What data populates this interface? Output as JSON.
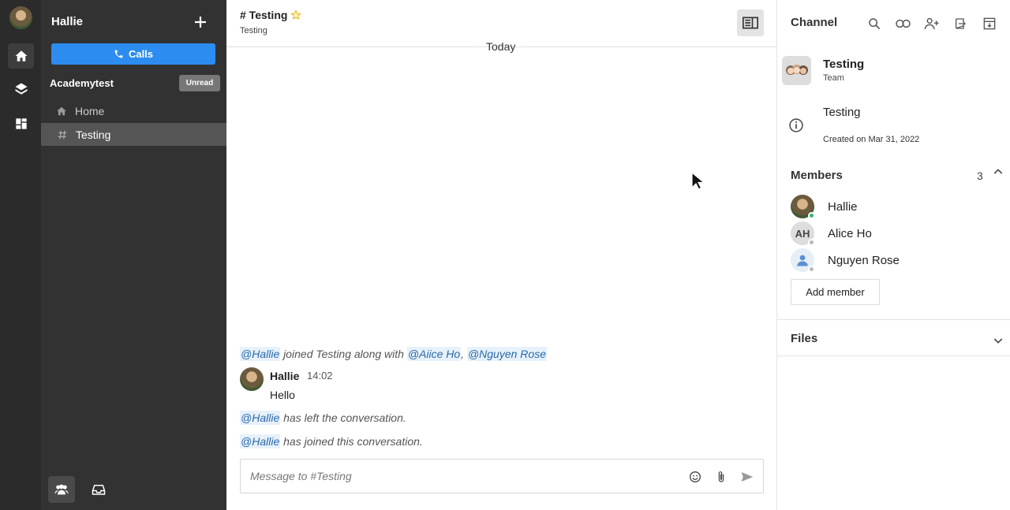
{
  "rail": {
    "icons": [
      "home-icon",
      "layers-icon",
      "dashboard-icon"
    ]
  },
  "sidebar": {
    "user_name": "Hallie",
    "calls_label": "Calls",
    "team_name": "Academytest",
    "unread_label": "Unread",
    "items": [
      {
        "label": "Home",
        "icon": "home-icon"
      },
      {
        "label": "Testing",
        "icon": "hash-icon",
        "active": true
      }
    ]
  },
  "main": {
    "channel_title": "# Testing",
    "channel_subtitle": "Testing",
    "date_divider": "Today",
    "system_messages": [
      {
        "mention": "@Hallie",
        "text": " joined Testing along with ",
        "mention2": "@Aiice Ho",
        "sep": ", ",
        "mention3": "@Nguyen Rose"
      },
      {
        "mention": "@Hallie",
        "text": " has left the conversation."
      },
      {
        "mention": "@Hallie",
        "text": " has joined this conversation."
      }
    ],
    "message": {
      "author": "Hallie",
      "time": "14:02",
      "text": "Hello"
    },
    "composer_placeholder": "Message to #Testing"
  },
  "right_panel": {
    "title": "Channel",
    "team_title": "Testing",
    "team_type": "Team",
    "description": "Testing",
    "created": "Created on Mar 31, 2022",
    "members_heading": "Members",
    "members_count": "3",
    "members": [
      {
        "name": "Hallie",
        "initials": "",
        "status": "online"
      },
      {
        "name": "Alice Ho",
        "initials": "AH",
        "status": "offline"
      },
      {
        "name": "Nguyen Rose",
        "initials": "",
        "status": "offline"
      }
    ],
    "add_member_label": "Add member",
    "files_heading": "Files"
  },
  "colors": {
    "accent": "#2d8cf0",
    "sidebar_bg": "#323232",
    "rail_bg": "#2b2b2b",
    "online": "#3cb371",
    "offline": "#bbbbbb",
    "star": "#f2c200"
  }
}
